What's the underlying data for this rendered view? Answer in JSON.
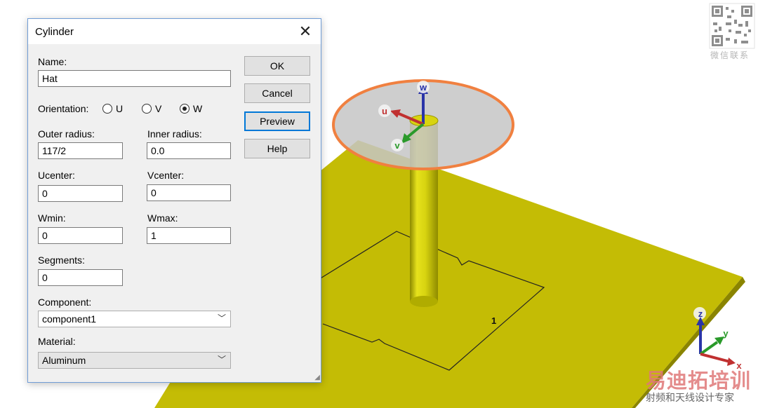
{
  "dialog": {
    "title": "Cylinder",
    "name_label": "Name:",
    "name_value": "Hat",
    "orientation_label": "Orientation:",
    "orientation_options": [
      "U",
      "V",
      "W"
    ],
    "orientation_selected": "W",
    "outer_radius_label": "Outer radius:",
    "outer_radius_value": "117/2",
    "inner_radius_label": "Inner radius:",
    "inner_radius_value": "0.0",
    "ucenter_label": "Ucenter:",
    "ucenter_value": "0",
    "vcenter_label": "Vcenter:",
    "vcenter_value": "0",
    "wmin_label": "Wmin:",
    "wmin_value": "0",
    "wmax_label": "Wmax:",
    "wmax_value": "1",
    "segments_label": "Segments:",
    "segments_value": "0",
    "component_label": "Component:",
    "component_value": "component1",
    "material_label": "Material:",
    "material_value": "Aluminum",
    "buttons": {
      "ok": "OK",
      "cancel": "Cancel",
      "preview": "Preview",
      "help": "Help"
    }
  },
  "viewport": {
    "port_label": "1",
    "local_axes": {
      "u": "u",
      "v": "v",
      "w": "w"
    },
    "global_axes": {
      "x": "x",
      "y": "y",
      "z": "z"
    },
    "colors": {
      "ground": "#c4bc05",
      "cylinder": "#d8d410",
      "hat": "#c6c6c6",
      "hat_outline": "#f08040"
    }
  },
  "watermark": {
    "qr_caption": "微信联系",
    "brand": "易迪拓培训",
    "subtitle": "射频和天线设计专家"
  }
}
